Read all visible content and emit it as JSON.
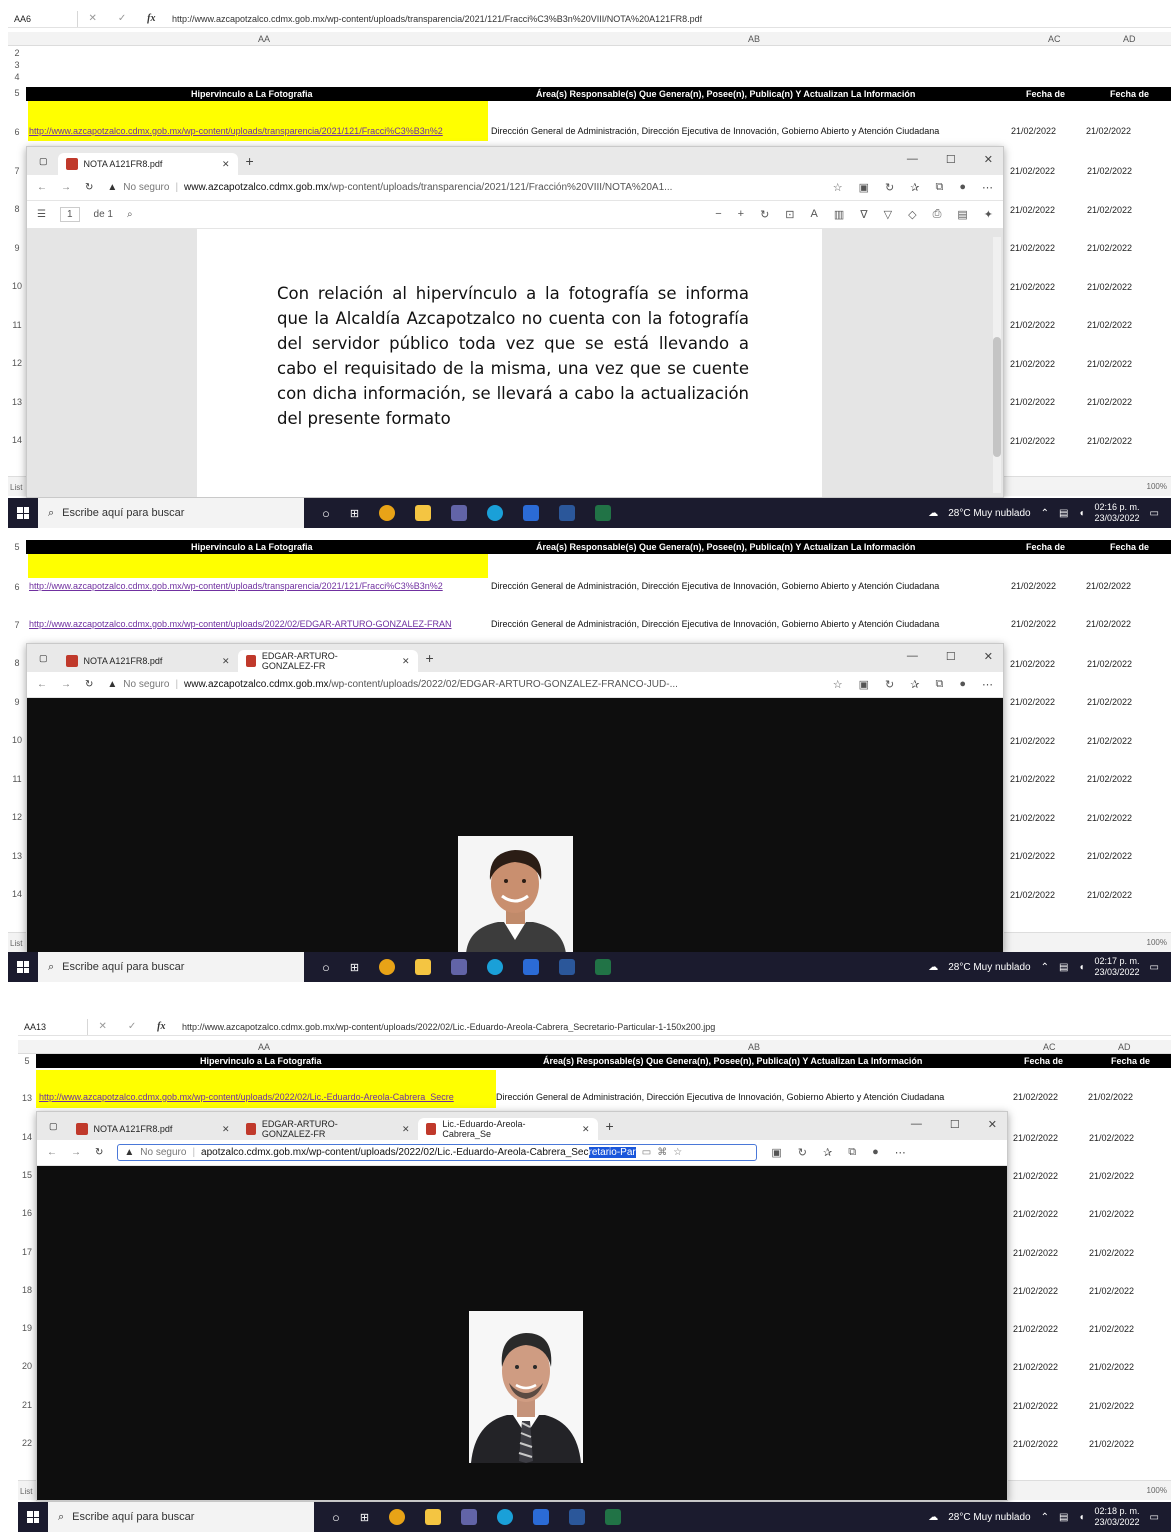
{
  "excel": {
    "col_headers": [
      "AA",
      "AB",
      "AC",
      "AD"
    ],
    "header_row": {
      "aa": "Hipervinculo a La Fotografia",
      "ab": "Área(s) Responsable(s) Que Genera(n), Posee(n), Publica(n) Y Actualizan La Información",
      "ac": "Fecha de",
      "ad": "Fecha de"
    },
    "area_text": "Dirección General de Administración, Dirección Ejecutiva de Innovación, Gobierno Abierto y Atención Ciudadana",
    "date": "21/02/2022",
    "sheet_list_label": "List",
    "zoom_label": "100%"
  },
  "shot1": {
    "name_box": "AA6",
    "formula": "http://www.azcapotzalco.cdmx.gob.mx/wp-content/uploads/transparencia/2021/121/Fracci%C3%B3n%20VIII/NOTA%20A121FR8.pdf",
    "row_numbers": [
      "2",
      "3",
      "4",
      "5",
      "6",
      "7",
      "8",
      "9",
      "10",
      "11",
      "12",
      "13",
      "14"
    ],
    "link_row6": "http://www.azcapotzalco.cdmx.gob.mx/wp-content/uploads/transparencia/2021/121/Fracci%C3%B3n%2",
    "browser": {
      "tab1": "NOTA A121FR8.pdf",
      "insecure": "No seguro",
      "url_host": "www.azcapotzalco.cdmx.gob.mx",
      "url_path": "/wp-content/uploads/transparencia/2021/121/Fracción%20VIII/NOTA%20A1...",
      "page_num": "1",
      "page_total": "de 1"
    },
    "pdf_text": "Con relación al hipervínculo a la fotografía se informa que la Alcaldía Azcapotzalco no cuenta con la fotografía del servidor público toda vez que se está llevando a cabo el requisitado de la misma, una vez que se cuente con dicha información, se llevará a cabo la actualización del presente formato",
    "clock_time": "02:16 p. m.",
    "clock_date": "23/03/2022"
  },
  "shot2": {
    "row_numbers": [
      "5",
      "6",
      "7",
      "8",
      "9",
      "10",
      "11",
      "12",
      "13",
      "14"
    ],
    "link_row6": "http://www.azcapotzalco.cdmx.gob.mx/wp-content/uploads/transparencia/2021/121/Fracci%C3%B3n%2",
    "link_row7": "http://www.azcapotzalco.cdmx.gob.mx/wp-content/uploads/2022/02/EDGAR-ARTURO-GONZALEZ-FRAN",
    "browser": {
      "tab1": "NOTA A121FR8.pdf",
      "tab2": "EDGAR-ARTURO-GONZALEZ-FR",
      "insecure": "No seguro",
      "url_host": "www.azcapotzalco.cdmx.gob.mx",
      "url_path": "/wp-content/uploads/2022/02/EDGAR-ARTURO-GONZALEZ-FRANCO-JUD-..."
    },
    "clock_time": "02:17 p. m.",
    "clock_date": "23/03/2022"
  },
  "shot3": {
    "name_box": "AA13",
    "formula": "http://www.azcapotzalco.cdmx.gob.mx/wp-content/uploads/2022/02/Lic.-Eduardo-Areola-Cabrera_Secretario-Particular-1-150x200.jpg",
    "row_numbers": [
      "5",
      "13",
      "14",
      "15",
      "16",
      "17",
      "18",
      "19",
      "20",
      "21",
      "22"
    ],
    "link_row13": "http://www.azcapotzalco.cdmx.gob.mx/wp-content/uploads/2022/02/Lic.-Eduardo-Areola-Cabrera_Secre",
    "browser": {
      "tab1": "NOTA A121FR8.pdf",
      "tab2": "EDGAR-ARTURO-GONZALEZ-FR",
      "tab3": "Lic.-Eduardo-Areola-Cabrera_Se",
      "insecure": "No seguro",
      "url_plain": "apotzalco.cdmx.gob.mx/wp-content/uploads/2022/02/Lic.-Eduardo-Areola-Cabrera_Sec",
      "url_selected": "retario-Par"
    },
    "clock_time": "02:18 p. m.",
    "clock_date": "23/03/2022"
  },
  "taskbar": {
    "search_placeholder": "Escribe aquí para buscar",
    "weather": "28°C Muy nublado"
  },
  "colors": {
    "taskbar": "#1b1b2e",
    "header_row": "#000000",
    "link_highlight": "#ffff00",
    "link_text": "#7030a0",
    "viewer_bg": "#0e0e0e"
  }
}
